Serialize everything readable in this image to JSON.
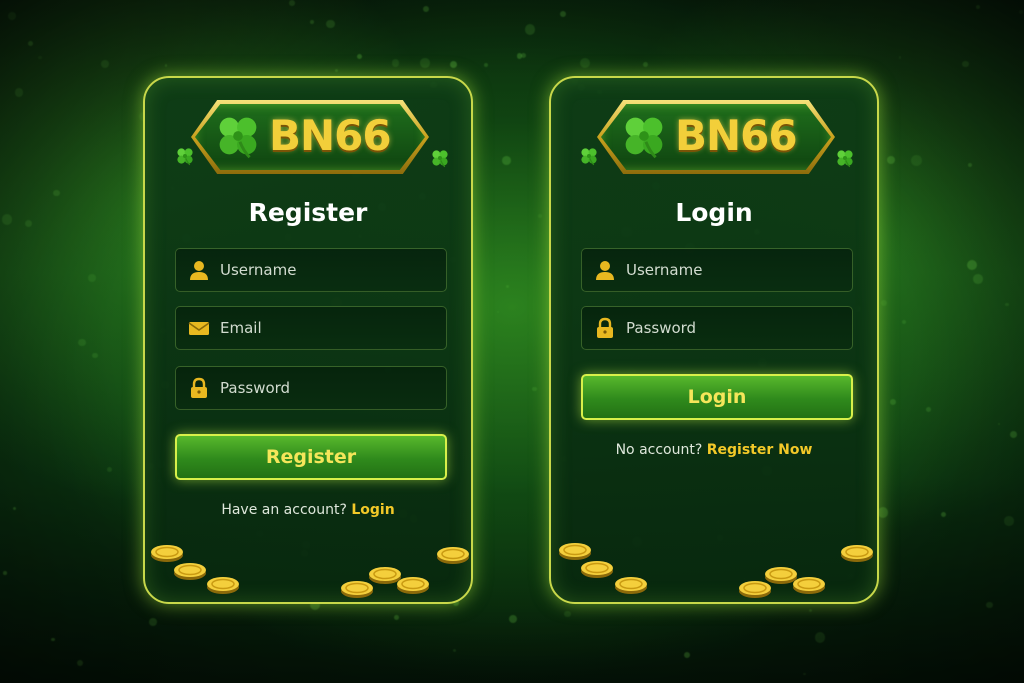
{
  "brand": {
    "logo_text": "BN66",
    "logo_icon": "four-leaf-clover-icon"
  },
  "register": {
    "title": "Register",
    "username_placeholder": "Username",
    "email_placeholder": "Email",
    "password_placeholder": "Password",
    "submit_label": "Register",
    "switch_prompt": "Have an account?",
    "switch_link": "Login"
  },
  "login": {
    "title": "Login",
    "username_placeholder": "Username",
    "password_placeholder": "Password",
    "submit_label": "Login",
    "switch_prompt": "No account?",
    "switch_link": "Register Now"
  },
  "icons": {
    "username": "user-icon",
    "email": "envelope-icon",
    "password": "lock-icon"
  },
  "colors": {
    "accent_gold": "#f3c928",
    "button_green": "#2f8a1c",
    "border_lime": "#d8f04a",
    "background_green": "#0c3a12"
  }
}
